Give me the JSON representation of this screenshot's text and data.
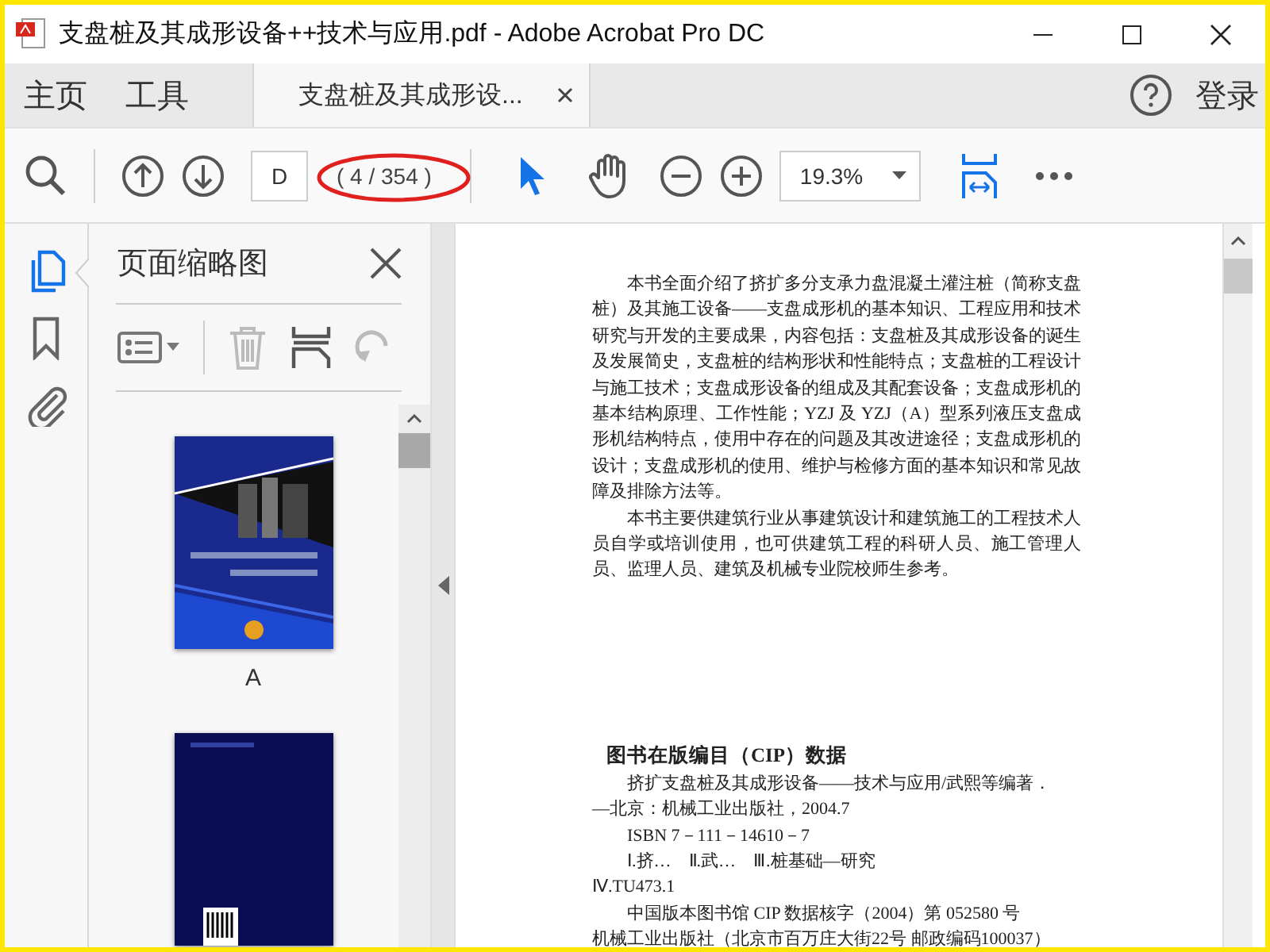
{
  "window": {
    "title": "支盘桩及其成形设备++技术与应用.pdf - Adobe Acrobat Pro DC"
  },
  "nav": [
    {
      "label": "主页",
      "selected": false
    },
    {
      "label": "工具",
      "selected": false
    },
    {
      "label": "支盘桩及其成形设...",
      "selected": true
    }
  ],
  "account": {
    "label": "登录"
  },
  "toolbar": {
    "page_field": {
      "value": "D"
    },
    "page_count": "( 4 / 354 )",
    "annotation": {
      "kind": "ellipse"
    },
    "tools": [
      {
        "kind": "select",
        "selected": true
      },
      {
        "kind": "hand",
        "selected": false
      }
    ],
    "zoom": {
      "value": "19.3%"
    }
  },
  "sidebar": {
    "items": [
      {
        "kind": "thumbnails",
        "selected": true
      },
      {
        "kind": "bookmarks",
        "selected": false
      },
      {
        "kind": "attachments",
        "selected": false
      }
    ]
  },
  "thumbnail_panel": {
    "title": "页面缩略图",
    "thumbnails": [
      {
        "kind": "front-cover",
        "label": "A"
      },
      {
        "kind": "back-cover"
      }
    ]
  },
  "document": {
    "paragraphs": [
      "本书全面介绍了挤扩多分支承力盘混凝土灌注桩（简称支盘桩）及其施工设备——支盘成形机的基本知识、工程应用和技术研究与开发的主要成果，内容包括：支盘桩及其成形设备的诞生及发展简史，支盘桩的结构形状和性能特点；支盘桩的工程设计与施工技术；支盘成形设备的组成及其配套设备；支盘成形机的基本结构原理、工作性能；YZJ 及 YZJ（A）型系列液压支盘成形机结构特点，使用中存在的问题及其改进途径；支盘成形机的设计；支盘成形机的使用、维护与检修方面的基本知识和常见故障及排除方法等。",
      "本书主要供建筑行业从事建筑设计和建筑施工的工程技术人员自学或培训使用，也可供建筑工程的科研人员、施工管理人员、监理人员、建筑及机械专业院校师生参考。"
    ],
    "cip_title": "图书在版编目（CIP）数据",
    "cip_lines": [
      {
        "kind": "indent",
        "text": "挤扩支盘桩及其成形设备——技术与应用/武熙等编著．"
      },
      {
        "kind": "flush",
        "text": "—北京：机械工业出版社，2004.7"
      },
      {
        "kind": "indent",
        "text": "ISBN 7－111－14610－7"
      },
      {
        "kind": "indent",
        "text": "Ⅰ.挤…　Ⅱ.武…　Ⅲ.桩基础—研究"
      },
      {
        "kind": "flush",
        "text": "Ⅳ.TU473.1"
      },
      {
        "kind": "indent",
        "text": "中国版本图书馆 CIP 数据核字（2004）第 052580 号"
      },
      {
        "kind": "flush",
        "text": "机械工业出版社（北京市百万庄大街22号 邮政编码100037）"
      }
    ]
  }
}
